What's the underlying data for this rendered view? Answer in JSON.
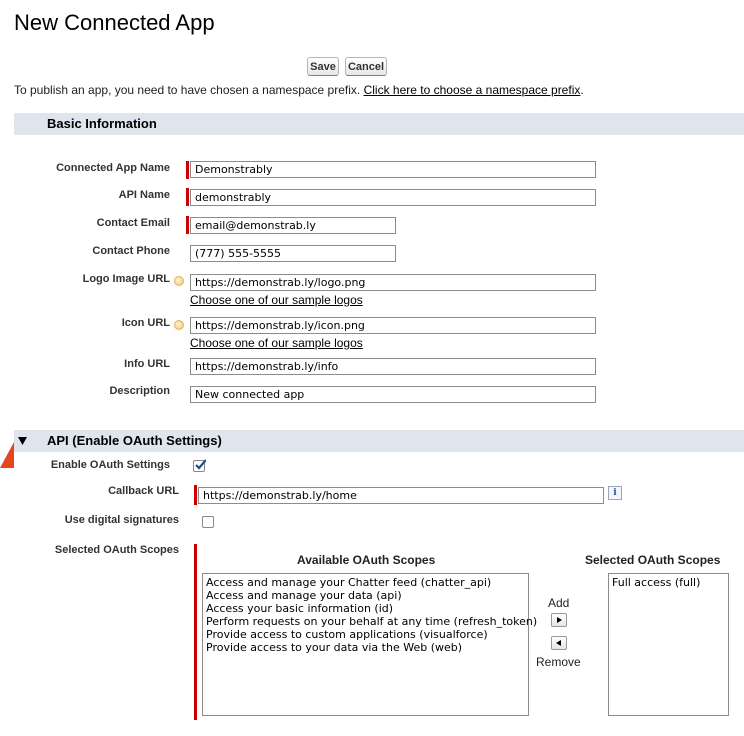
{
  "page": {
    "title": "New Connected App"
  },
  "toolbar": {
    "save_label": "Save",
    "cancel_label": "Cancel"
  },
  "notice": {
    "text": "To publish an app, you need to have chosen a namespace prefix. ",
    "link": "Click here to choose a namespace prefix",
    "suffix": "."
  },
  "basic_info": {
    "heading": "Basic Information",
    "connected_app_name": {
      "label": "Connected App Name",
      "value": "Demonstrably"
    },
    "api_name": {
      "label": "API Name",
      "value": "demonstrably"
    },
    "contact_email": {
      "label": "Contact Email",
      "value": "email@demonstrab.ly"
    },
    "contact_phone": {
      "label": "Contact Phone",
      "value": "(777) 555-5555"
    },
    "logo_image_url": {
      "label": "Logo Image URL",
      "value": "https://demonstrab.ly/logo.png",
      "link": "Choose one of our sample logos"
    },
    "icon_url": {
      "label": "Icon URL",
      "value": "https://demonstrab.ly/icon.png",
      "link": "Choose one of our sample logos"
    },
    "info_url": {
      "label": "Info URL",
      "value": "https://demonstrab.ly/info"
    },
    "description": {
      "label": "Description",
      "value": "New connected app"
    }
  },
  "api": {
    "heading": "API (Enable OAuth Settings)",
    "enable_oauth": {
      "label": "Enable OAuth Settings",
      "checked": true
    },
    "callback_url": {
      "label": "Callback URL",
      "value": "https://demonstrab.ly/home",
      "info_icon": "i"
    },
    "digital_signatures": {
      "label": "Use digital signatures",
      "checked": false
    },
    "scopes_label": "Selected OAuth Scopes",
    "available_heading": "Available OAuth Scopes",
    "selected_heading": "Selected OAuth Scopes",
    "available": [
      "Access and manage your Chatter feed (chatter_api)",
      "Access and manage your data (api)",
      "Access your basic information (id)",
      "Perform requests on your behalf at any time (refresh_token)",
      "Provide access to custom applications (visualforce)",
      "Provide access to your data via the Web (web)"
    ],
    "selected": [
      "Full access (full)"
    ],
    "add_label": "Add",
    "remove_label": "Remove"
  },
  "colors": {
    "required": "#cc0000",
    "section_bg": "#dfe5ec",
    "check": "#1f4e8c"
  }
}
